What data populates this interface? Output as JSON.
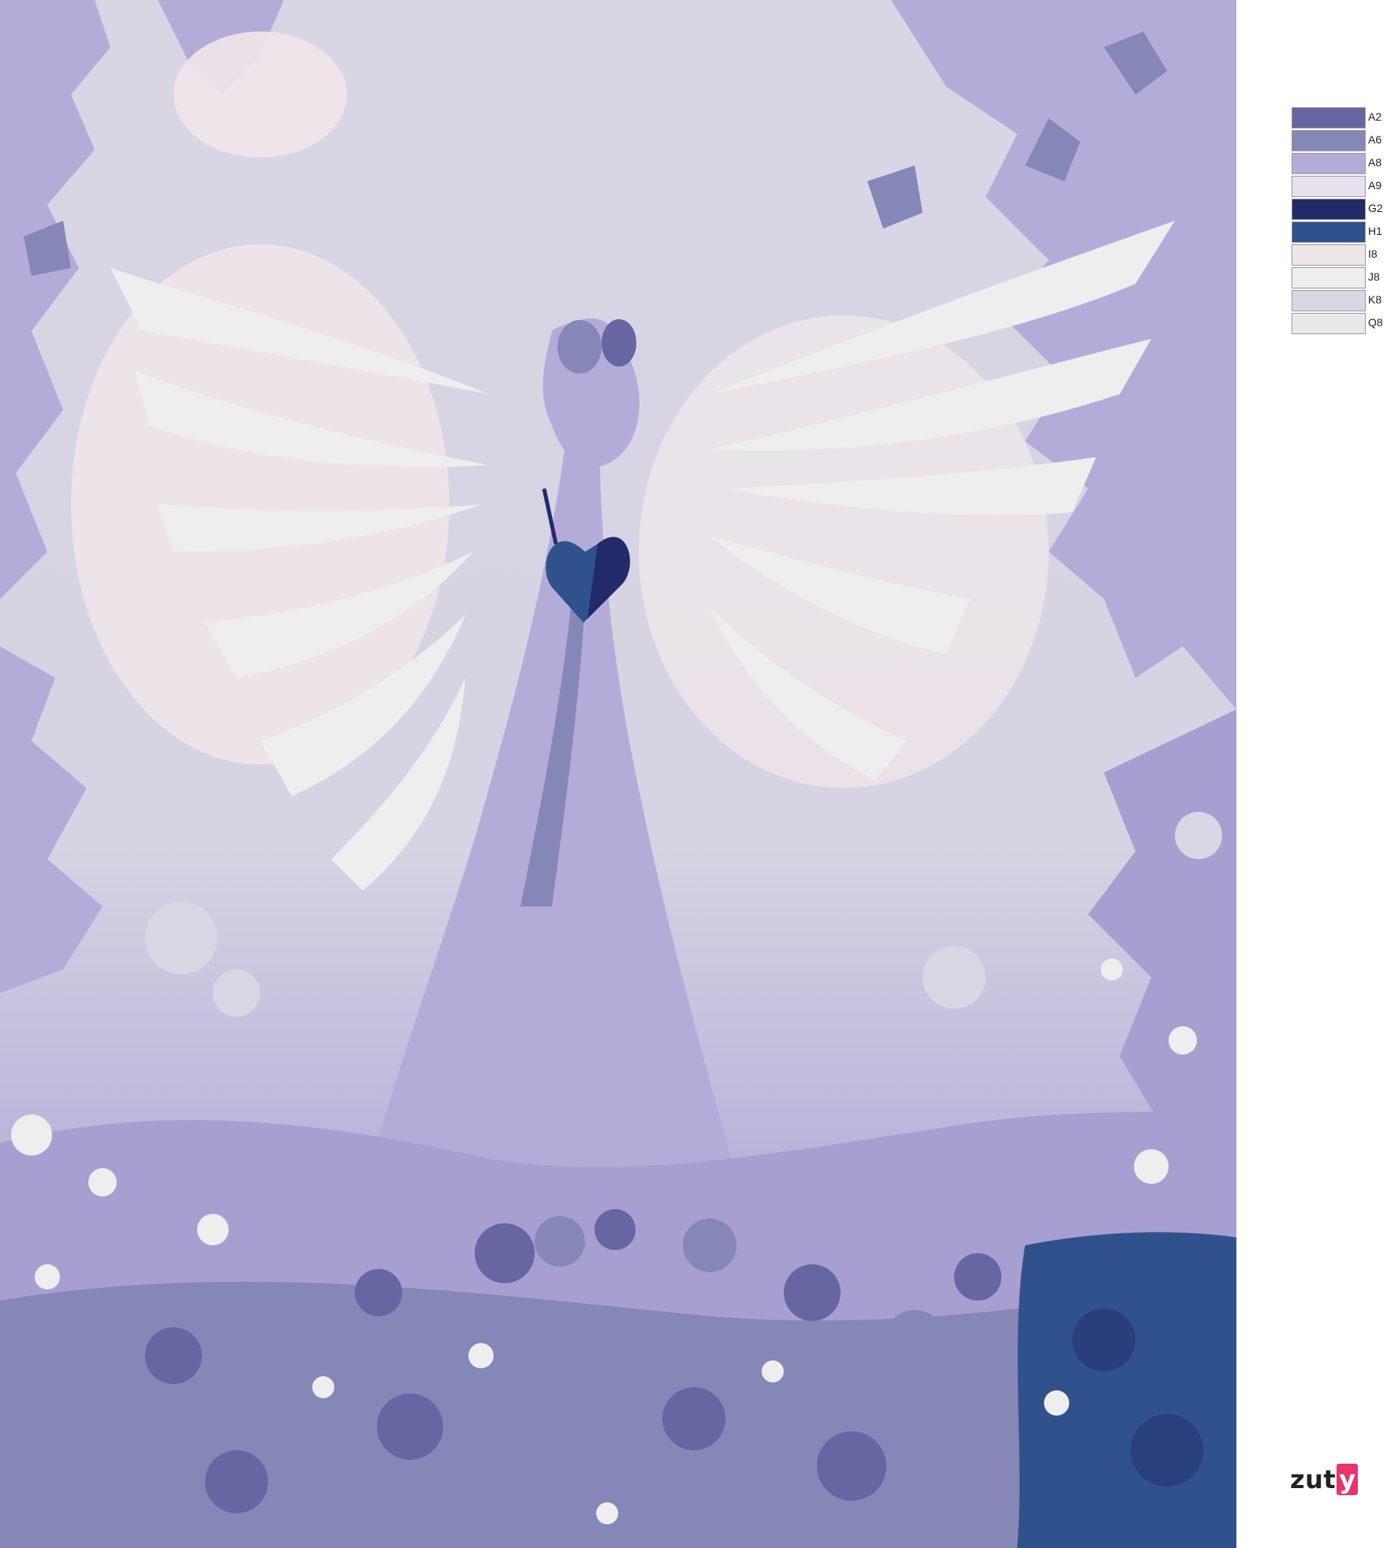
{
  "palette": {
    "items": [
      {
        "code": "A2",
        "color": "#6566a2"
      },
      {
        "code": "A6",
        "color": "#8587b7"
      },
      {
        "code": "A8",
        "color": "#b4acd8"
      },
      {
        "code": "A9",
        "color": "#e6e1ec"
      },
      {
        "code": "G2",
        "color": "#232a6a"
      },
      {
        "code": "H1",
        "color": "#2f528c"
      },
      {
        "code": "I8",
        "color": "#efe6ea"
      },
      {
        "code": "J8",
        "color": "#eeeeee"
      },
      {
        "code": "K8",
        "color": "#d8d7e3"
      },
      {
        "code": "Q8",
        "color": "#eae8ec"
      }
    ]
  },
  "brand": {
    "text": "zut",
    "accent": "y",
    "accent_color": "#e8346f"
  },
  "artwork": {
    "subject": "angel-figure-icon"
  }
}
